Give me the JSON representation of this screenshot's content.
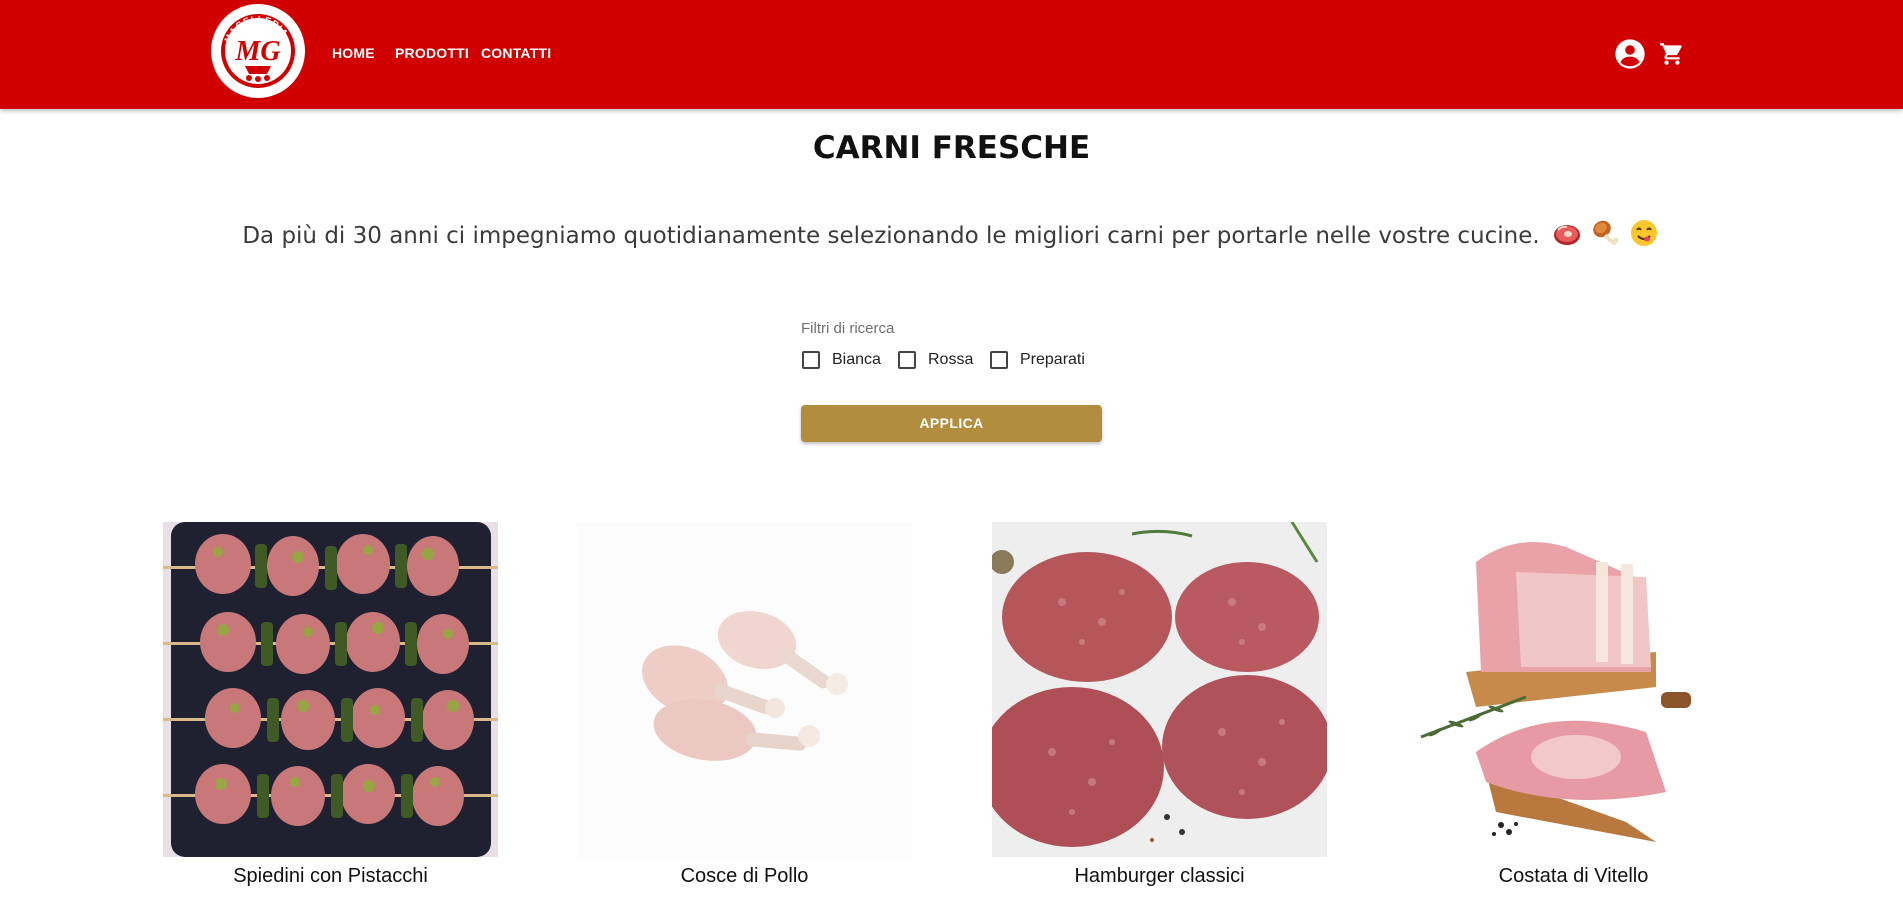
{
  "header": {
    "logo_text": "MACELLERIA",
    "logo_monogram": "MG",
    "nav": {
      "home": "HOME",
      "prodotti": "PRODOTTI",
      "contatti": "CONTATTI"
    },
    "icons": [
      "account-circle-icon",
      "shopping-cart-icon"
    ],
    "background_color": "#d10000"
  },
  "main": {
    "title": "CARNI FRESCHE",
    "tagline": "Da più di 30 anni ci impegniamo quotidianamente selezionando le migliori carni per portarle nelle vostre cucine.",
    "tagline_emojis": [
      "meat-emoji",
      "poultry-leg-emoji",
      "yum-face-emoji"
    ]
  },
  "filters": {
    "legend": "Filtri di ricerca",
    "options": [
      {
        "label": "Bianca",
        "checked": false
      },
      {
        "label": "Rossa",
        "checked": false
      },
      {
        "label": "Preparati",
        "checked": false
      }
    ],
    "apply_label": "APPLICA",
    "apply_color": "#b38d3e"
  },
  "products": [
    {
      "name": "Spiedini con Pistacchi"
    },
    {
      "name": "Cosce di Pollo"
    },
    {
      "name": "Hamburger classici"
    },
    {
      "name": "Costata di Vitello"
    }
  ]
}
